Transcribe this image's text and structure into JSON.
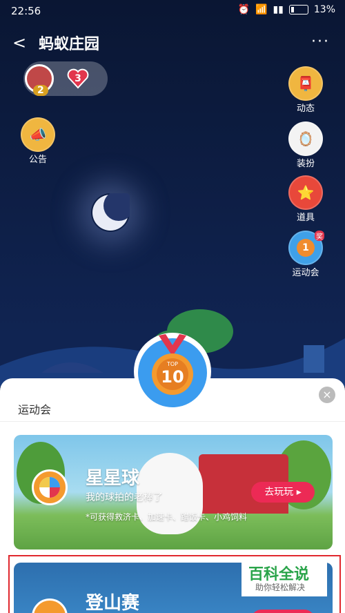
{
  "status": {
    "time": "22:56",
    "battery": "13%"
  },
  "header": {
    "title": "蚂蚁庄园"
  },
  "profile": {
    "level": "2",
    "hearts": "3"
  },
  "side_left": [
    {
      "label": "公告",
      "icon": "megaphone-icon"
    }
  ],
  "side_right": [
    {
      "label": "动态",
      "icon": "mailbox-icon"
    },
    {
      "label": "装扮",
      "icon": "mirror-icon"
    },
    {
      "label": "道具",
      "icon": "star-icon"
    },
    {
      "label": "运动会",
      "icon": "medal-icon",
      "badge": "奖",
      "medal_number": "1"
    }
  ],
  "panel": {
    "title": "运动会",
    "medal_text": "TOP",
    "medal_number": "10"
  },
  "cards": [
    {
      "title": "星星球",
      "subtitle": "我的球拍的老棒了",
      "note": "*可获得救济卡、加速卡、蹭饭卡、小鸡饲料",
      "button": "去玩玩"
    },
    {
      "title": "登山赛"
    }
  ],
  "watermark": {
    "line1": "百科全说",
    "line2": "助你轻松解决"
  }
}
